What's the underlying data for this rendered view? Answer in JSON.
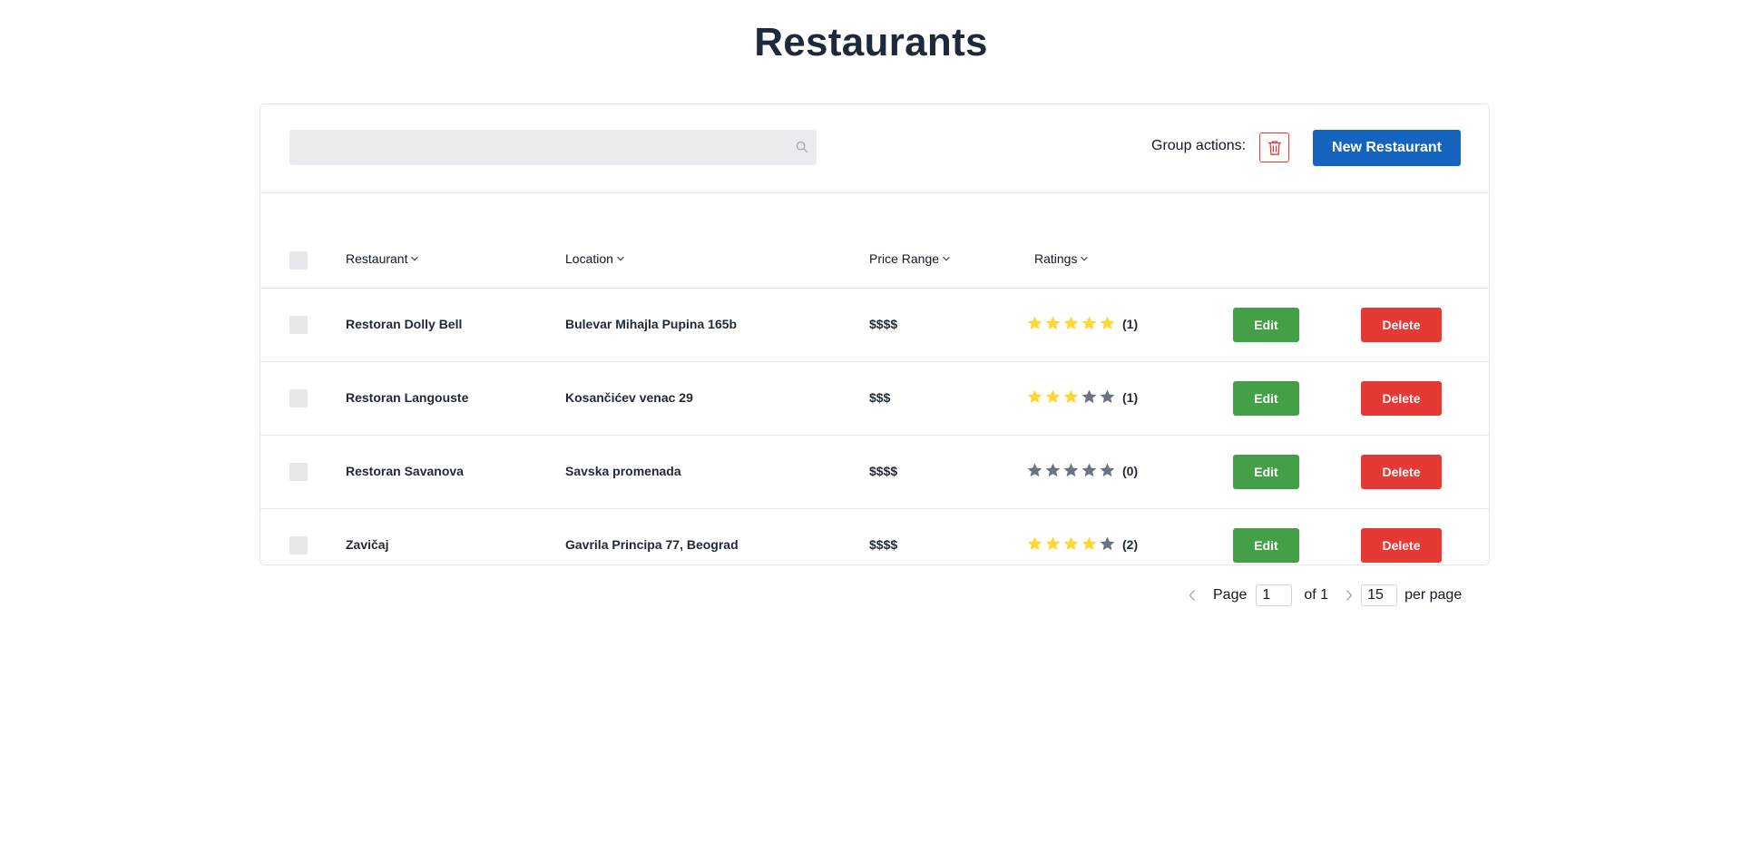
{
  "page": {
    "title": "Restaurants"
  },
  "toolbar": {
    "search_placeholder": "",
    "search_value": "",
    "group_actions_label": "Group actions:",
    "new_button_label": "New Restaurant"
  },
  "table": {
    "columns": [
      {
        "label": "Restaurant"
      },
      {
        "label": "Location"
      },
      {
        "label": "Price Range"
      },
      {
        "label": "Ratings"
      }
    ],
    "rows": [
      {
        "name": "Restoran Dolly Bell",
        "location": "Bulevar Mihajla Pupina 165b",
        "price": "$$$$",
        "rating": 5,
        "count": "(1)",
        "edit": "Edit",
        "delete": "Delete"
      },
      {
        "name": "Restoran Langouste",
        "location": "Kosančićev venac 29",
        "price": "$$$",
        "rating": 3,
        "count": "(1)",
        "edit": "Edit",
        "delete": "Delete"
      },
      {
        "name": "Restoran Savanova",
        "location": "Savska promenada",
        "price": "$$$$",
        "rating": 0,
        "count": "(0)",
        "edit": "Edit",
        "delete": "Delete"
      },
      {
        "name": "Zavičaj",
        "location": "Gavrila Principa 77, Beograd",
        "price": "$$$$",
        "rating": 4,
        "count": "(2)",
        "edit": "Edit",
        "delete": "Delete"
      }
    ]
  },
  "pagination": {
    "page_label": "Page",
    "current_page": "1",
    "of_label": "of 1",
    "per_page_value": "15",
    "per_page_label": "per page"
  },
  "colors": {
    "primary": "#1565c0",
    "edit": "#43a047",
    "delete": "#e53935",
    "star_filled": "#fdd835",
    "star_empty": "#6b7280"
  },
  "icons": {
    "search": "search-icon",
    "trash": "trash-icon",
    "sort": "chevron-down-icon",
    "star": "star-icon",
    "prev": "chevron-left-icon",
    "next": "chevron-right-icon"
  }
}
